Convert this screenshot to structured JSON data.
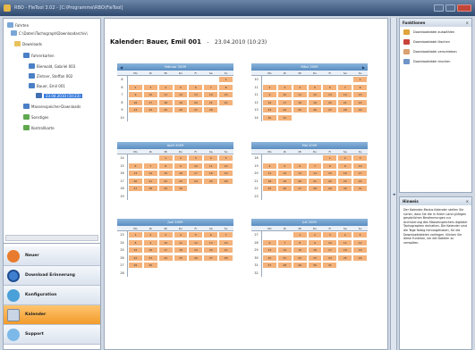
{
  "window": {
    "title": "RBO - FleTool 3.02 - [C:\\Programme\\RBO\\FleTool]"
  },
  "tree": {
    "items": [
      {
        "label": "Fahrten",
        "icon": "pc-icon"
      },
      {
        "label": "C:\\Daten\\Tachograph\\Downloadarchiv\\",
        "icon": "pc-icon"
      },
      {
        "label": "Downloads",
        "icon": "folder-icon"
      },
      {
        "label": "Fahrerkarten",
        "icon": "folder-icon"
      },
      {
        "label": "Bierwald, Gabriel 003",
        "icon": "card-icon"
      },
      {
        "label": "Zintner, Steffan 002",
        "icon": "card-icon"
      },
      {
        "label": "Bauer, Emil 001",
        "icon": "card-icon"
      },
      {
        "label": "23.04.2010 (10:23)",
        "icon": "calendar-icon"
      },
      {
        "label": "Massenspeicher-Downloads",
        "icon": "folder-icon"
      },
      {
        "label": "Sonstiges",
        "icon": "folder-icon"
      },
      {
        "label": "Kontrollkarte",
        "icon": "folder-icon"
      }
    ]
  },
  "nav": {
    "items": [
      {
        "label": "Neuer",
        "icon": "new-icon"
      },
      {
        "label": "Download Erinnerung",
        "icon": "clock-icon"
      },
      {
        "label": "Konfiguration",
        "icon": "gears-icon"
      },
      {
        "label": "Kalender",
        "icon": "calendar-icon",
        "active": true
      },
      {
        "label": "Support",
        "icon": "support-icon"
      }
    ]
  },
  "calendar": {
    "title_prefix": "Kalender:",
    "driver": "Bauer, Emil 001",
    "separator": "-",
    "date": "23.04.2010 (10:23)",
    "day_names": [
      "Mo",
      "Di",
      "Mi",
      "Do",
      "Fr",
      "Sa",
      "So"
    ],
    "months": [
      {
        "name": "Februar 2009",
        "weeks": [
          {
            "wk": "6",
            "days": [
              "",
              "",
              "",
              "",
              "",
              "",
              "1"
            ]
          },
          {
            "wk": "6",
            "days": [
              "2",
              "3",
              "4",
              "5",
              "6",
              "7",
              "8"
            ]
          },
          {
            "wk": "7",
            "days": [
              "9",
              "10",
              "11",
              "12",
              "13",
              "14",
              "15"
            ]
          },
          {
            "wk": "8",
            "days": [
              "16",
              "17",
              "18",
              "19",
              "20",
              "21",
              "22"
            ]
          },
          {
            "wk": "9",
            "days": [
              "23",
              "24",
              "25",
              "26",
              "27",
              "28",
              ""
            ]
          },
          {
            "wk": "10",
            "days": [
              "",
              "",
              "",
              "",
              "",
              "",
              ""
            ]
          }
        ]
      },
      {
        "name": "März 2009",
        "weeks": [
          {
            "wk": "10",
            "days": [
              "",
              "",
              "",
              "",
              "",
              "",
              "1"
            ]
          },
          {
            "wk": "11",
            "days": [
              "2",
              "3",
              "4",
              "5",
              "6",
              "7",
              "8"
            ]
          },
          {
            "wk": "11",
            "days": [
              "9",
              "10",
              "11",
              "12",
              "13",
              "14",
              "15"
            ]
          },
          {
            "wk": "12",
            "days": [
              "16",
              "17",
              "18",
              "19",
              "20",
              "21",
              "22"
            ]
          },
          {
            "wk": "13",
            "days": [
              "23",
              "24",
              "25",
              "26",
              "27",
              "28",
              "29"
            ]
          },
          {
            "wk": "14",
            "days": [
              "30",
              "31",
              "",
              "",
              "",
              "",
              ""
            ]
          }
        ]
      },
      {
        "name": "April 2009",
        "weeks": [
          {
            "wk": "14",
            "days": [
              "",
              "",
              "1",
              "2",
              "3",
              "4",
              "5"
            ]
          },
          {
            "wk": "15",
            "days": [
              "6",
              "7",
              "8",
              "9",
              "10",
              "11",
              "12"
            ]
          },
          {
            "wk": "16",
            "days": [
              "13",
              "14",
              "15",
              "16",
              "17",
              "18",
              "19"
            ]
          },
          {
            "wk": "17",
            "days": [
              "20",
              "21",
              "22",
              "23",
              "24",
              "25",
              "26"
            ]
          },
          {
            "wk": "18",
            "days": [
              "27",
              "28",
              "29",
              "30",
              "",
              "",
              ""
            ]
          },
          {
            "wk": "19",
            "days": [
              "",
              "",
              "",
              "",
              "",
              "",
              ""
            ]
          }
        ]
      },
      {
        "name": "Mai 2009",
        "weeks": [
          {
            "wk": "18",
            "days": [
              "",
              "",
              "",
              "",
              "1",
              "2",
              "3"
            ]
          },
          {
            "wk": "19",
            "days": [
              "4",
              "5",
              "6",
              "7",
              "8",
              "9",
              "10"
            ]
          },
          {
            "wk": "20",
            "days": [
              "11",
              "12",
              "13",
              "14",
              "15",
              "16",
              "17"
            ]
          },
          {
            "wk": "21",
            "days": [
              "18",
              "19",
              "20",
              "21",
              "22",
              "23",
              "24"
            ]
          },
          {
            "wk": "22",
            "days": [
              "25",
              "26",
              "27",
              "28",
              "29",
              "30",
              "31"
            ]
          },
          {
            "wk": "23",
            "days": [
              "",
              "",
              "",
              "",
              "",
              "",
              ""
            ]
          }
        ]
      },
      {
        "name": "Juni 2009",
        "weeks": [
          {
            "wk": "23",
            "days": [
              "1",
              "2",
              "3",
              "4",
              "5",
              "6",
              "7"
            ]
          },
          {
            "wk": "24",
            "days": [
              "8",
              "9",
              "10",
              "11",
              "12",
              "13",
              "14"
            ]
          },
          {
            "wk": "25",
            "days": [
              "15",
              "16",
              "17",
              "18",
              "19",
              "20",
              "21"
            ]
          },
          {
            "wk": "26",
            "days": [
              "22",
              "23",
              "24",
              "25",
              "26",
              "27",
              "28"
            ]
          },
          {
            "wk": "27",
            "days": [
              "29",
              "30",
              "",
              "",
              "",
              "",
              ""
            ]
          },
          {
            "wk": "28",
            "days": [
              "",
              "",
              "",
              "",
              "",
              "",
              ""
            ]
          }
        ]
      },
      {
        "name": "Juli 2009",
        "weeks": [
          {
            "wk": "27",
            "days": [
              "",
              "",
              "1",
              "2",
              "3",
              "4",
              "5"
            ]
          },
          {
            "wk": "28",
            "days": [
              "6",
              "7",
              "8",
              "9",
              "10",
              "11",
              "12"
            ]
          },
          {
            "wk": "29",
            "days": [
              "13",
              "14",
              "15",
              "16",
              "17",
              "18",
              "19"
            ]
          },
          {
            "wk": "30",
            "days": [
              "20",
              "21",
              "22",
              "23",
              "24",
              "25",
              "26"
            ]
          },
          {
            "wk": "31",
            "days": [
              "27",
              "28",
              "29",
              "30",
              "31",
              "",
              ""
            ]
          },
          {
            "wk": "32",
            "days": [
              "",
              "",
              "",
              "",
              "",
              "",
              ""
            ]
          }
        ]
      }
    ]
  },
  "functions": {
    "title": "Funktionen",
    "items": [
      {
        "label": "Downloaddatei auswählen",
        "icon": "folder-open-icon"
      },
      {
        "label": "Downloaddatei löschen",
        "icon": "delete-icon"
      },
      {
        "label": "Downloaddatei verschieben",
        "icon": "move-icon"
      },
      {
        "label": "Downloaddatei drucken",
        "icon": "print-icon"
      }
    ]
  },
  "hints": {
    "title": "Hinweis",
    "text": "Der Kalender-Modus Kalender stellen Sie sicher, dass Sie die in Ihrem Land gültigen gesetzlichen Bestimmungen zur Archivierung des Massenspeichers digitaler Tachographen einhalten. Die Kalender sind die Tage farbig hervorgehoben, für die Downloaddateien vorliegen. Klicken Sie diese Funktion, um die Dateien zu verwalten."
  },
  "colors": {
    "accent": "#f29b2b",
    "day_fill": "#f4b27a",
    "month_header": "#5a8dc0"
  }
}
